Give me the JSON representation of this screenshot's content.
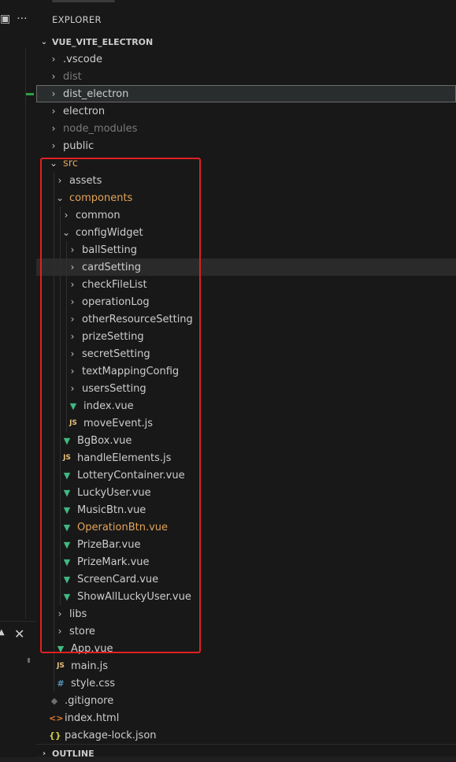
{
  "left_panel": {
    "layout_icon": "▣",
    "more_icon": "···",
    "close_symbol": "✕",
    "triangle_symbol": "▲"
  },
  "explorer": {
    "title": "EXPLORER",
    "root_label": "VUE_VITE_ELECTRON",
    "outline_label": "OUTLINE"
  },
  "tree": [
    {
      "label": ".vscode",
      "type": "folder",
      "depth": 0,
      "expanded": false
    },
    {
      "label": "dist",
      "type": "folder",
      "depth": 0,
      "expanded": false,
      "dim": true
    },
    {
      "label": "dist_electron",
      "type": "folder",
      "depth": 0,
      "expanded": false,
      "selected": true
    },
    {
      "label": "electron",
      "type": "folder",
      "depth": 0,
      "expanded": false
    },
    {
      "label": "node_modules",
      "type": "folder",
      "depth": 0,
      "expanded": false,
      "dim": true
    },
    {
      "label": "public",
      "type": "folder",
      "depth": 0,
      "expanded": false
    },
    {
      "label": "src",
      "type": "folder",
      "depth": 0,
      "expanded": true,
      "orange": true
    },
    {
      "label": "assets",
      "type": "folder",
      "depth": 1,
      "expanded": false
    },
    {
      "label": "components",
      "type": "folder",
      "depth": 1,
      "expanded": true,
      "orange": true
    },
    {
      "label": "common",
      "type": "folder",
      "depth": 2,
      "expanded": false
    },
    {
      "label": "configWidget",
      "type": "folder",
      "depth": 2,
      "expanded": true
    },
    {
      "label": "ballSetting",
      "type": "folder",
      "depth": 3,
      "expanded": false
    },
    {
      "label": "cardSetting",
      "type": "folder",
      "depth": 3,
      "expanded": false,
      "hover": true
    },
    {
      "label": "checkFileList",
      "type": "folder",
      "depth": 3,
      "expanded": false
    },
    {
      "label": "operationLog",
      "type": "folder",
      "depth": 3,
      "expanded": false
    },
    {
      "label": "otherResourceSetting",
      "type": "folder",
      "depth": 3,
      "expanded": false
    },
    {
      "label": "prizeSetting",
      "type": "folder",
      "depth": 3,
      "expanded": false
    },
    {
      "label": "secretSetting",
      "type": "folder",
      "depth": 3,
      "expanded": false
    },
    {
      "label": "textMappingConfig",
      "type": "folder",
      "depth": 3,
      "expanded": false
    },
    {
      "label": "usersSetting",
      "type": "folder",
      "depth": 3,
      "expanded": false
    },
    {
      "label": "index.vue",
      "type": "vue",
      "depth": 3
    },
    {
      "label": "moveEvent.js",
      "type": "js",
      "depth": 3
    },
    {
      "label": "BgBox.vue",
      "type": "vue",
      "depth": 2
    },
    {
      "label": "handleElements.js",
      "type": "js",
      "depth": 2
    },
    {
      "label": "LotteryContainer.vue",
      "type": "vue",
      "depth": 2
    },
    {
      "label": "LuckyUser.vue",
      "type": "vue",
      "depth": 2
    },
    {
      "label": "MusicBtn.vue",
      "type": "vue",
      "depth": 2
    },
    {
      "label": "OperationBtn.vue",
      "type": "vue",
      "depth": 2,
      "orange": true
    },
    {
      "label": "PrizeBar.vue",
      "type": "vue",
      "depth": 2
    },
    {
      "label": "PrizeMark.vue",
      "type": "vue",
      "depth": 2
    },
    {
      "label": "ScreenCard.vue",
      "type": "vue",
      "depth": 2
    },
    {
      "label": "ShowAllLuckyUser.vue",
      "type": "vue",
      "depth": 2
    },
    {
      "label": "libs",
      "type": "folder",
      "depth": 1,
      "expanded": false
    },
    {
      "label": "store",
      "type": "folder",
      "depth": 1,
      "expanded": false
    },
    {
      "label": "App.vue",
      "type": "vue",
      "depth": 1
    },
    {
      "label": "main.js",
      "type": "js",
      "depth": 1
    },
    {
      "label": "style.css",
      "type": "css",
      "depth": 1
    },
    {
      "label": ".gitignore",
      "type": "git",
      "depth": 0
    },
    {
      "label": "index.html",
      "type": "html",
      "depth": 0
    },
    {
      "label": "package-lock.json",
      "type": "json",
      "depth": 0
    }
  ],
  "icons": {
    "vue": "▼",
    "js": "JS",
    "css": "#",
    "git": "◆",
    "html": "<>",
    "json": "{}",
    "collapsed": "›",
    "expanded": "⌄"
  },
  "colors": {
    "background": "#181818",
    "highlight_border": "#e02020",
    "vue": "#41b883",
    "modified_orange": "#e2a35b"
  }
}
